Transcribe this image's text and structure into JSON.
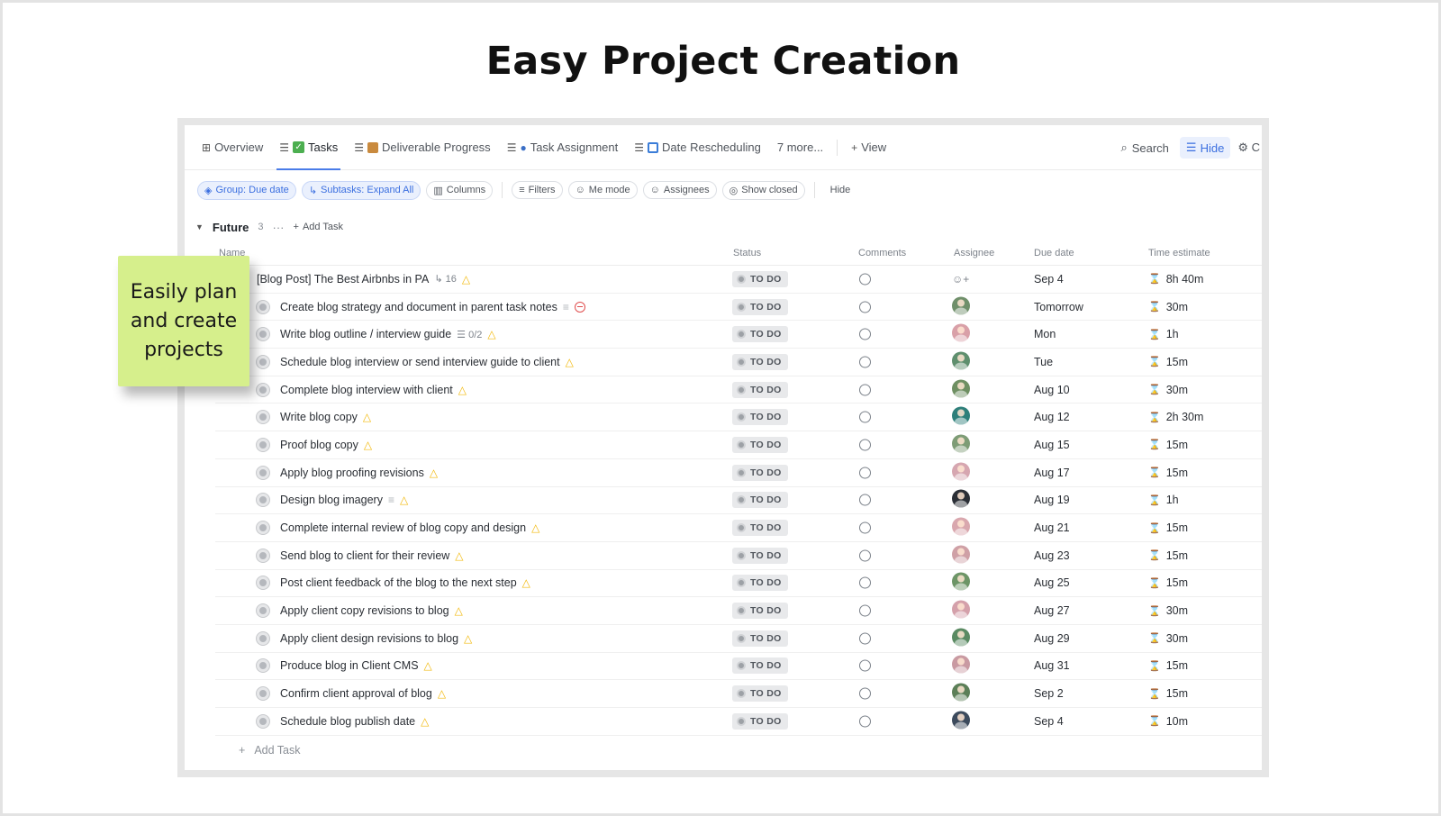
{
  "slide": {
    "title": "Easy Project Creation",
    "callout": "Easily plan\nand create\nprojects",
    "callout_color": "#d6ef8c"
  },
  "tabs": [
    {
      "label": "Overview",
      "icon": "overview-icon"
    },
    {
      "label": "Tasks",
      "icon": "tasks-list-icon",
      "active": true
    },
    {
      "label": "Deliverable Progress",
      "icon": "list-icon"
    },
    {
      "label": "Task Assignment",
      "icon": "list-icon"
    },
    {
      "label": "Date Rescheduling",
      "icon": "list-icon"
    },
    {
      "label": "7 more...",
      "icon": ""
    },
    {
      "label": "View",
      "icon": "plus-icon"
    }
  ],
  "toolbar": {
    "search_label": "Search",
    "hide_label": "Hide",
    "settings_label": "C"
  },
  "chips": {
    "group": "Group: Due date",
    "subtasks": "Subtasks: Expand All",
    "columns": "Columns",
    "filters": "Filters",
    "me_mode": "Me mode",
    "assignees": "Assignees",
    "show_closed": "Show closed",
    "hide": "Hide"
  },
  "group": {
    "name": "Future",
    "count": "3",
    "add_task": "Add Task"
  },
  "columns": {
    "name": "Name",
    "status": "Status",
    "comments": "Comments",
    "assignee": "Assignee",
    "due_date": "Due date",
    "time_estimate": "Time estimate"
  },
  "accent_color": "#4a7ce8",
  "rows": [
    {
      "name": "[Blog Post] The Best Airbnbs in PA",
      "meta": "16",
      "status": "TO DO",
      "due": "Sep 4",
      "time": "8h 40m",
      "parent": true
    },
    {
      "name": "Create blog strategy and document in parent task notes",
      "status": "TO DO",
      "due": "Tomorrow",
      "time": "30m"
    },
    {
      "name": "Write blog outline / interview guide",
      "meta": "0/2",
      "status": "TO DO",
      "due": "Mon",
      "time": "1h"
    },
    {
      "name": "Schedule blog interview or send interview guide to client",
      "status": "TO DO",
      "due": "Tue",
      "time": "15m"
    },
    {
      "name": "Complete blog interview with client",
      "status": "TO DO",
      "due": "Aug 10",
      "time": "30m"
    },
    {
      "name": "Write blog copy",
      "status": "TO DO",
      "due": "Aug 12",
      "time": "2h 30m"
    },
    {
      "name": "Proof blog copy",
      "status": "TO DO",
      "due": "Aug 15",
      "time": "15m"
    },
    {
      "name": "Apply blog proofing revisions",
      "status": "TO DO",
      "due": "Aug 17",
      "time": "15m"
    },
    {
      "name": "Design blog imagery",
      "status": "TO DO",
      "due": "Aug 19",
      "time": "1h"
    },
    {
      "name": "Complete internal review of blog copy and design",
      "status": "TO DO",
      "due": "Aug 21",
      "time": "15m"
    },
    {
      "name": "Send blog to client for their review",
      "status": "TO DO",
      "due": "Aug 23",
      "time": "15m"
    },
    {
      "name": "Post client feedback of the blog to the next step",
      "status": "TO DO",
      "due": "Aug 25",
      "time": "15m"
    },
    {
      "name": "Apply client copy revisions to blog",
      "status": "TO DO",
      "due": "Aug 27",
      "time": "30m"
    },
    {
      "name": "Apply client design revisions to blog",
      "status": "TO DO",
      "due": "Aug 29",
      "time": "30m"
    },
    {
      "name": "Produce blog in Client CMS",
      "status": "TO DO",
      "due": "Aug 31",
      "time": "15m"
    },
    {
      "name": "Confirm client approval of blog",
      "status": "TO DO",
      "due": "Sep 2",
      "time": "15m"
    },
    {
      "name": "Schedule blog publish date",
      "status": "TO DO",
      "due": "Sep 4",
      "time": "10m"
    }
  ],
  "footer": {
    "add_task": "Add Task"
  }
}
